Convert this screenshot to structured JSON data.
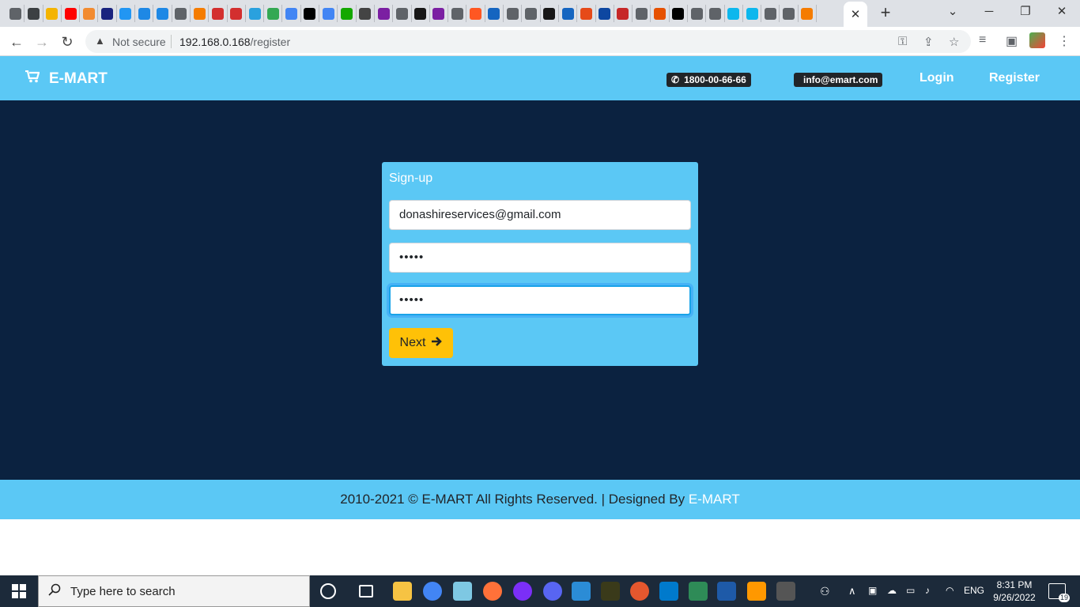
{
  "browser": {
    "favicon_colors": [
      "#5f6368",
      "#3c4043",
      "#f4b400",
      "#ff0000",
      "#f28b30",
      "#1a237e",
      "#2196f3",
      "#1e88e5",
      "#1e88e5",
      "#5f6368",
      "#f57c00",
      "#d32f2f",
      "#d32f2f",
      "#2aa1de",
      "#34a853",
      "#4285f4",
      "#000000",
      "#4285f4",
      "#14a800",
      "#444444",
      "#7b1fa2",
      "#5f6368",
      "#181717",
      "#7b1fa2",
      "#5f6368",
      "#ff5722",
      "#1565c0",
      "#5f6368",
      "#5f6368",
      "#181717",
      "#1565c0",
      "#e64a19",
      "#0d47a1",
      "#c62828",
      "#5f6368",
      "#e65100",
      "#000000",
      "#5f6368",
      "#5f6368",
      "#0db7ed",
      "#0db7ed",
      "#5f6368",
      "#5f6368",
      "#f57c00"
    ],
    "active_tab_close": "✕",
    "new_tab": "+",
    "minimize": "─",
    "chevron": "⌄",
    "maximize": "❐",
    "close": "✕",
    "not_secure_label": "Not secure",
    "url_host": "192.168.0.168",
    "url_path": "/register"
  },
  "site": {
    "brand": "E-MART",
    "phone": "1800-00-66-66",
    "email": "info@emart.com",
    "login": "Login",
    "register": "Register",
    "header_color": "#5bc8f5",
    "main_bg": "#0b2240"
  },
  "signup": {
    "title": "Sign-up",
    "email_value": "donashireservices@gmail.com",
    "password_value": "•••••",
    "confirm_value": "•••••",
    "next_label": "Next",
    "button_color": "#ffc107"
  },
  "footer": {
    "text": "2010-2021 © E-MART All Rights Reserved. | Designed By ",
    "accent": "E-MART"
  },
  "taskbar": {
    "search_placeholder": "Type here to search",
    "language": "ENG",
    "time": "8:31 PM",
    "date": "9/26/2022",
    "notifications": "19"
  }
}
